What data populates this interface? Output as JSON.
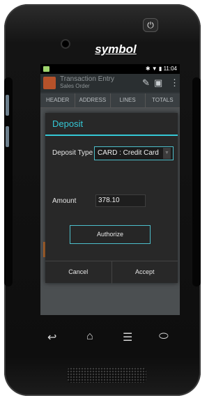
{
  "device": {
    "brand": "symbol",
    "power_icon": "power-icon"
  },
  "statusbar": {
    "time": "11:04",
    "icons": [
      "bluetooth-icon",
      "wifi-icon",
      "battery-icon"
    ]
  },
  "appbar": {
    "title": "Transaction Entry",
    "subtitle": "Sales Order",
    "actions": [
      "edit-icon",
      "save-icon",
      "more-icon"
    ]
  },
  "tabs": [
    "HEADER",
    "ADDRESS",
    "LINES",
    "TOTALS"
  ],
  "dialog": {
    "title": "Deposit",
    "deposit_type_label": "Deposit Type",
    "deposit_type_value": "CARD : Credit Card",
    "amount_label": "Amount",
    "amount_value": "378.10",
    "authorize_label": "Authorize",
    "cancel_label": "Cancel",
    "accept_label": "Accept"
  },
  "nav": {
    "back_icon": "back-icon",
    "home_icon": "home-icon",
    "menu_icon": "menu-icon",
    "search_icon": "search-icon"
  },
  "colors": {
    "accent": "#35c8d6",
    "dialog_bg": "#282828",
    "app_icon": "#b6522a"
  }
}
